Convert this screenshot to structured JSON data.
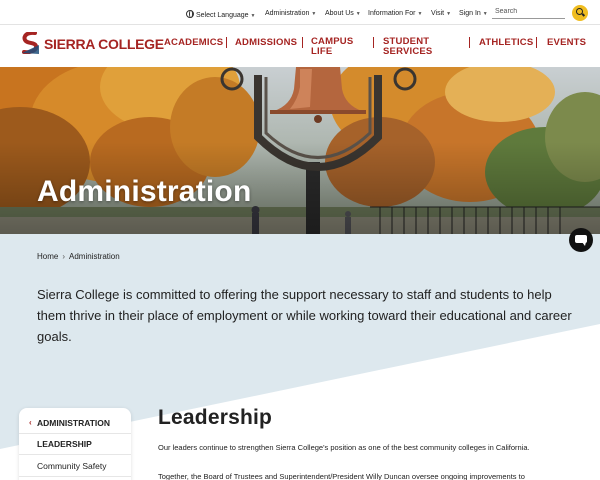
{
  "utility": {
    "language": "Select Language",
    "links": [
      "Administration",
      "About Us",
      "Information For",
      "Visit",
      "Sign In"
    ],
    "search_placeholder": "Search"
  },
  "brand": {
    "name": "SIERRA COLLEGE",
    "color": "#a52422"
  },
  "nav": {
    "academics": "ACADEMICS",
    "admissions": "ADMISSIONS",
    "campus_1": "CAMPUS",
    "campus_2": "LIFE",
    "student_1": "STUDENT",
    "student_2": "SERVICES",
    "athletics": "ATHLETICS",
    "events": "EVENTS"
  },
  "hero": {
    "title": "Administration"
  },
  "breadcrumb": {
    "home": "Home",
    "current": "Administration"
  },
  "intro": {
    "text": "Sierra College is committed to offering the support necessary to staff and students to help them thrive in their place of employment or while working toward their educational and career goals."
  },
  "side_menu": {
    "parent": "ADMINISTRATION",
    "items": [
      "LEADERSHIP",
      "Community Safety"
    ]
  },
  "leadership": {
    "title": "Leadership",
    "p1": "Our leaders continue to strengthen Sierra College's position as one of the best community colleges in California.",
    "p2": "Together, the Board of Trustees and Superintendent/President Willy Duncan oversee ongoing improvements to"
  },
  "colors": {
    "accent": "#a52422",
    "search_button": "#f0bd20",
    "intro_bg": "#dde8ee"
  },
  "icons": [
    "globe-icon",
    "search-icon",
    "chat-icon",
    "chevron-left-icon",
    "sierra-college-logo"
  ]
}
